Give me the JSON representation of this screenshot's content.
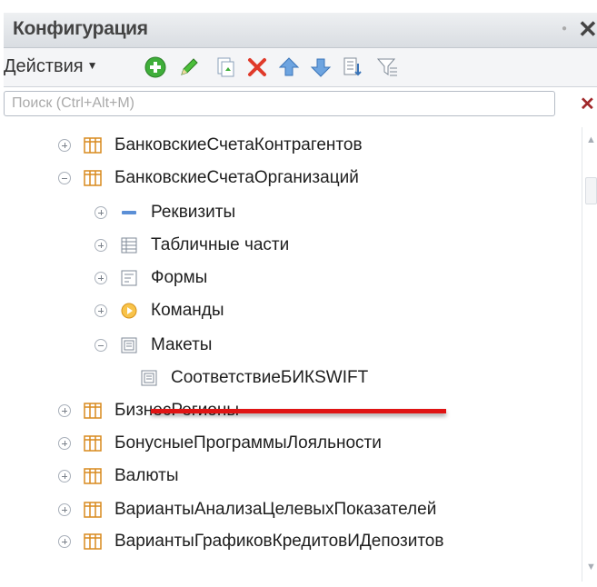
{
  "title": "Конфигурация",
  "toolbar": {
    "actions_label": "Действия",
    "icons": [
      "add-icon",
      "edit-icon",
      "copy-icon",
      "delete-icon",
      "move-up-icon",
      "move-down-icon",
      "sort-icon",
      "filter-icon"
    ]
  },
  "search": {
    "placeholder": "Поиск (Ctrl+Alt+M)",
    "value": ""
  },
  "tree": {
    "items": [
      {
        "label": "БанковскиеСчетаКонтрагентов",
        "icon": "table-icon",
        "state": "collapsed",
        "level": 1
      },
      {
        "label": "БанковскиеСчетаОрганизаций",
        "icon": "table-icon",
        "state": "expanded",
        "level": 1
      },
      {
        "label": "Реквизиты",
        "icon": "attributes-icon",
        "state": "collapsed",
        "level": 2
      },
      {
        "label": "Табличные части",
        "icon": "tabular-parts-icon",
        "state": "collapsed",
        "level": 2
      },
      {
        "label": "Формы",
        "icon": "forms-icon",
        "state": "collapsed",
        "level": 2
      },
      {
        "label": "Команды",
        "icon": "commands-icon",
        "state": "collapsed",
        "level": 2
      },
      {
        "label": "Макеты",
        "icon": "templates-icon",
        "state": "expanded",
        "level": 2
      },
      {
        "label": "СоответствиеБИКSWIFT",
        "icon": "template-icon",
        "state": "leaf",
        "level": 3
      },
      {
        "label": "БизнесРегионы",
        "icon": "table-icon",
        "state": "collapsed",
        "level": 1
      },
      {
        "label": "БонусныеПрограммыЛояльности",
        "icon": "table-icon",
        "state": "collapsed",
        "level": 1
      },
      {
        "label": "Валюты",
        "icon": "table-icon",
        "state": "collapsed",
        "level": 1
      },
      {
        "label": "ВариантыАнализаЦелевыхПоказателей",
        "icon": "table-icon",
        "state": "collapsed",
        "level": 1
      },
      {
        "label": "ВариантыГрафиковКредитовИДепозитов",
        "icon": "table-icon",
        "state": "collapsed",
        "level": 1
      }
    ]
  },
  "colors": {
    "highlight": "#e01414",
    "title_bg": "#dde1e6",
    "catalog_icon": "#e8a33d"
  }
}
